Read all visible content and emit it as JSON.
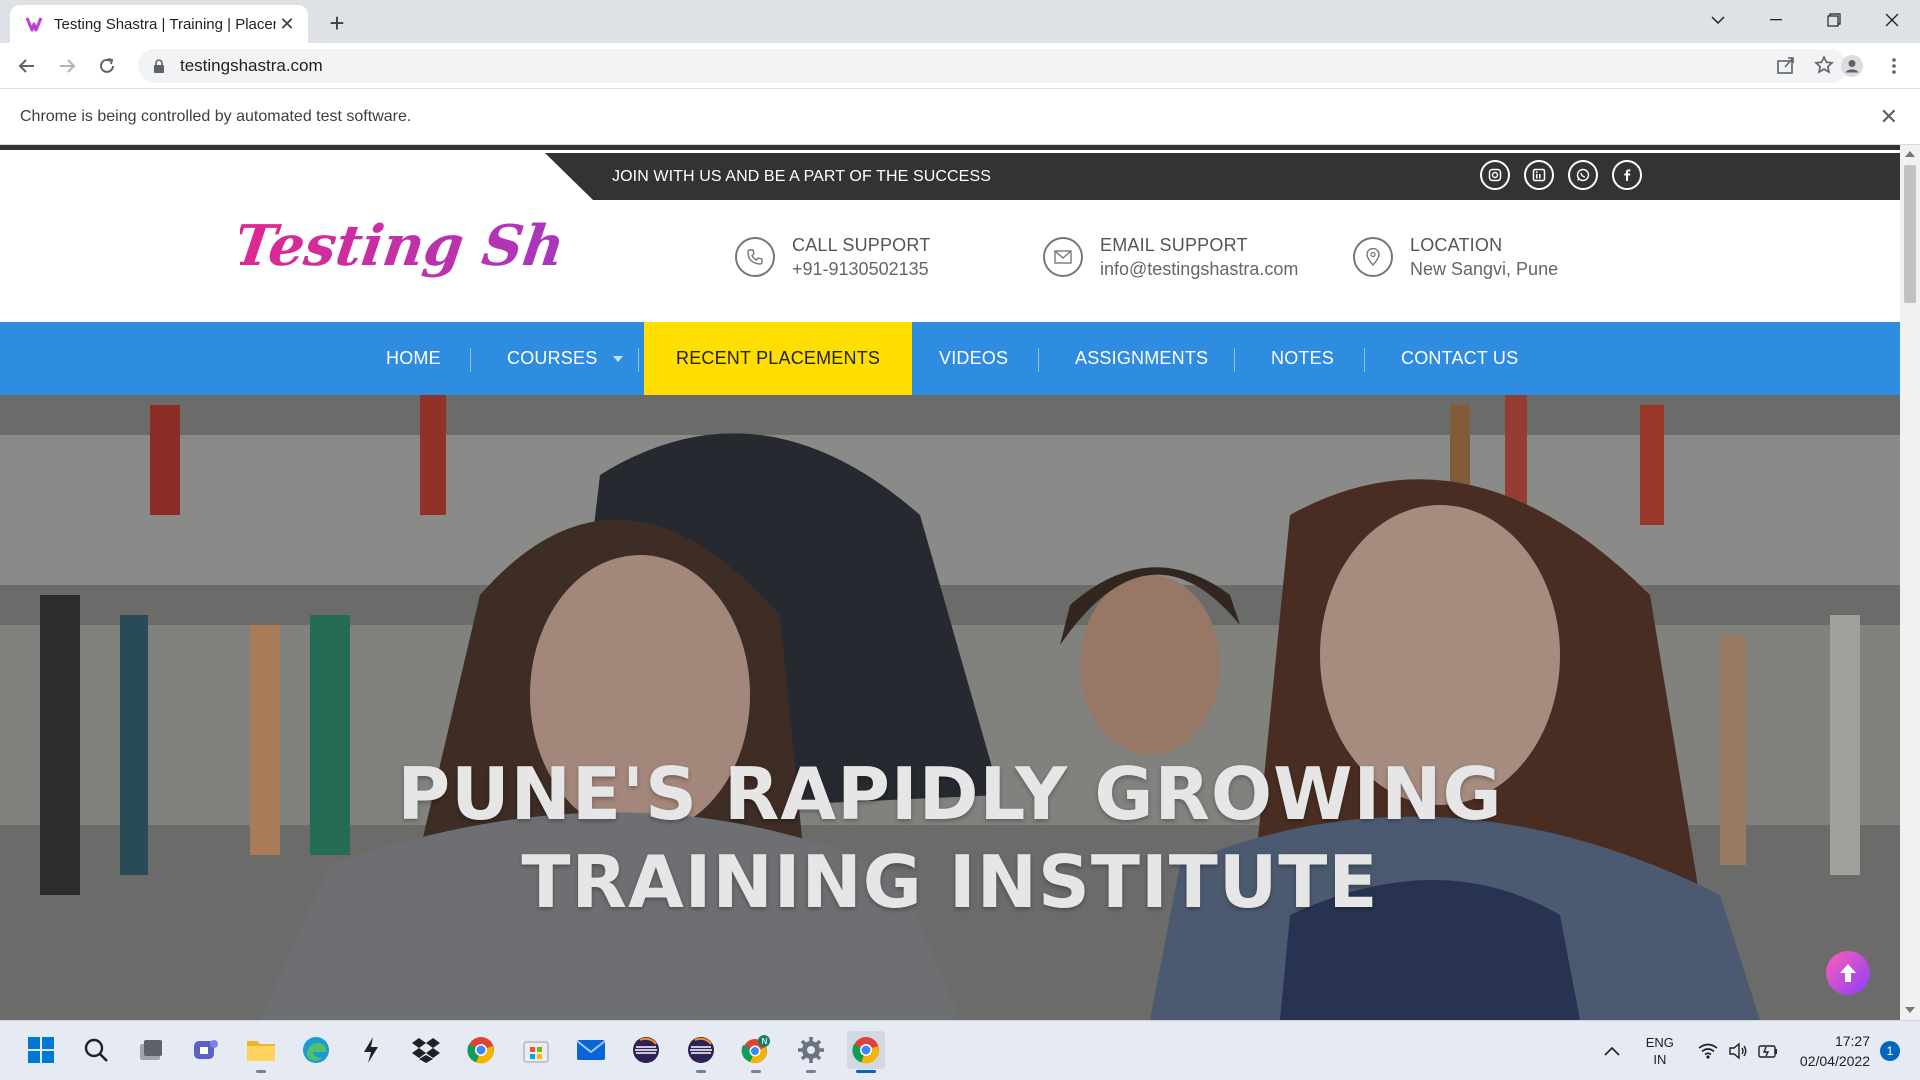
{
  "browser": {
    "tab_title": "Testing Shastra | Training | Placem",
    "url": "testingshastra.com",
    "infobar_message": "Chrome is being controlled by automated test software."
  },
  "site": {
    "tagline": "JOIN WITH US AND BE A PART OF THE SUCCESS",
    "social": [
      "instagram-icon",
      "linkedin-icon",
      "whatsapp-icon",
      "facebook-icon"
    ],
    "contacts": [
      {
        "title": "CALL SUPPORT",
        "value": "+91-9130502135",
        "icon": "phone-icon"
      },
      {
        "title": "EMAIL SUPPORT",
        "value": "info@testingshastra.com",
        "icon": "mail-icon"
      },
      {
        "title": "LOCATION",
        "value": "New Sangvi, Pune",
        "icon": "location-pin-icon"
      }
    ],
    "nav": [
      {
        "label": "HOME"
      },
      {
        "label": "COURSES",
        "dropdown": true
      },
      {
        "label": "RECENT PLACEMENTS",
        "active": true
      },
      {
        "label": "VIDEOS"
      },
      {
        "label": "ASSIGNMENTS"
      },
      {
        "label": "NOTES"
      },
      {
        "label": "CONTACT US"
      }
    ],
    "hero": {
      "line1": "PUNE'S RAPIDLY GROWING",
      "line2": "TRAINING INSTITUTE"
    },
    "colors": {
      "nav_bg": "#2e8de1",
      "nav_active": "#ffde00",
      "topbar_bg": "#333333",
      "logo_pink": "#e0288f",
      "logo_purple": "#8b3fd6"
    }
  },
  "taskbar": {
    "lang": "ENG",
    "region": "IN",
    "time": "17:27",
    "date": "02/04/2022",
    "notifications": "1"
  }
}
